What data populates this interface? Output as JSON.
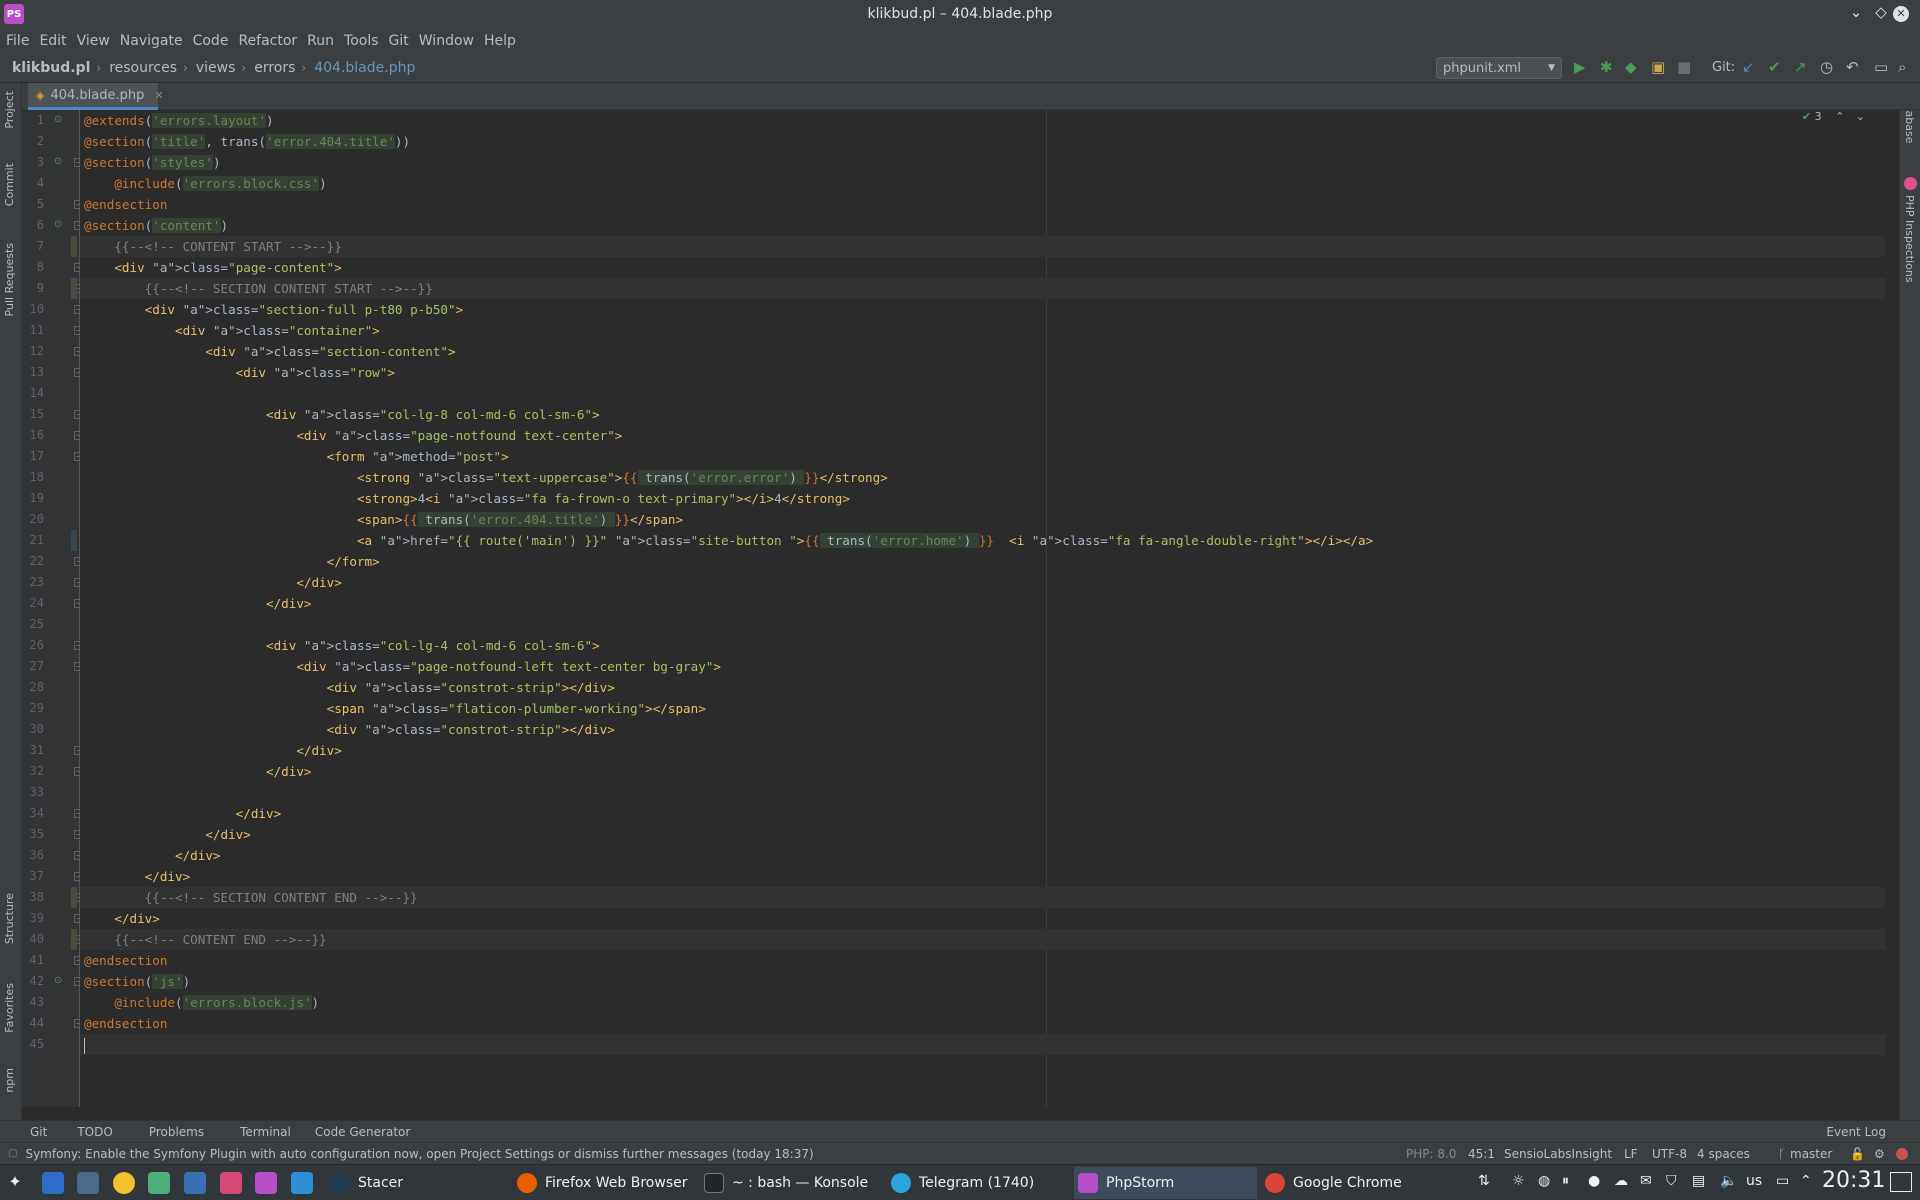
{
  "window": {
    "title": "klikbud.pl – 404.blade.php"
  },
  "menu": [
    "File",
    "Edit",
    "View",
    "Navigate",
    "Code",
    "Refactor",
    "Run",
    "Tools",
    "Git",
    "Window",
    "Help"
  ],
  "breadcrumb": [
    "klikbud.pl",
    "resources",
    "views",
    "errors",
    "404.blade.php"
  ],
  "run_config": "phpunit.xml",
  "git_label": "Git:",
  "tab": {
    "label": "404.blade.php"
  },
  "left_tools": [
    "Project",
    "Commit",
    "Pull Requests",
    "Structure",
    "Favorites",
    "npm"
  ],
  "right_tools": [
    "Database",
    "PHP Inspections"
  ],
  "inspections_count": "3",
  "code_lines": [
    "@extends('errors.layout')",
    "@section('title', trans('error.404.title'))",
    "@section('styles')",
    "    @include('errors.block.css')",
    "@endsection",
    "@section('content')",
    "    {{--<!-- CONTENT START -->--}}",
    "    <div class=\"page-content\">",
    "        {{--<!-- SECTION CONTENT START -->--}}",
    "        <div class=\"section-full p-t80 p-b50\">",
    "            <div class=\"container\">",
    "                <div class=\"section-content\">",
    "                    <div class=\"row\">",
    "",
    "                        <div class=\"col-lg-8 col-md-6 col-sm-6\">",
    "                            <div class=\"page-notfound text-center\">",
    "                                <form method=\"post\">",
    "                                    <strong class=\"text-uppercase\">{{ trans('error.error') }}</strong>",
    "                                    <strong>4<i class=\"fa fa-frown-o text-primary\"></i>4</strong>",
    "                                    <span>{{ trans('error.404.title') }}</span>",
    "                                    <a href=\"{{ route('main') }}\" class=\"site-button \">{{ trans('error.home') }}  <i class=\"fa fa-angle-double-right\"></i></a>",
    "                                </form>",
    "                            </div>",
    "                        </div>",
    "",
    "                        <div class=\"col-lg-4 col-md-6 col-sm-6\">",
    "                            <div class=\"page-notfound-left text-center bg-gray\">",
    "                                <div class=\"constrot-strip\"></div>",
    "                                <span class=\"flaticon-plumber-working\"></span>",
    "                                <div class=\"constrot-strip\"></div>",
    "                            </div>",
    "                        </div>",
    "",
    "                    </div>",
    "                </div>",
    "            </div>",
    "        </div>",
    "        {{--<!-- SECTION CONTENT END -->--}}",
    "    </div>",
    "    {{--<!-- CONTENT END -->--}}",
    "@endsection",
    "@section('js')",
    "    @include('errors.block.js')",
    "@endsection",
    ""
  ],
  "bottom_tools": [
    "Git",
    "TODO",
    "Problems",
    "Terminal",
    "Code Generator",
    "Event Log"
  ],
  "status": {
    "message": "Symfony: Enable the Symfony Plugin with auto configuration now, open Project Settings or dismiss further messages (today 18:37)",
    "php": "PHP: 8.0",
    "position": "45:1",
    "insight": "SensioLabsInsight",
    "line_sep": "LF",
    "encoding": "UTF-8",
    "indent": "4 spaces",
    "branch": "master"
  },
  "taskbar": {
    "tasks": [
      "Stacer",
      "Firefox Web Browser",
      "~ : bash — Konsole",
      "Telegram (1740)",
      "PhpStorm",
      "Google Chrome"
    ],
    "telegram_badge": "1740",
    "lang": "us",
    "clock": "20:31"
  },
  "colors": {
    "keyword": "#cc7832",
    "string": "#6a8759",
    "tag": "#e8bf6a",
    "comment": "#808080",
    "accent": "#4a88c7"
  }
}
